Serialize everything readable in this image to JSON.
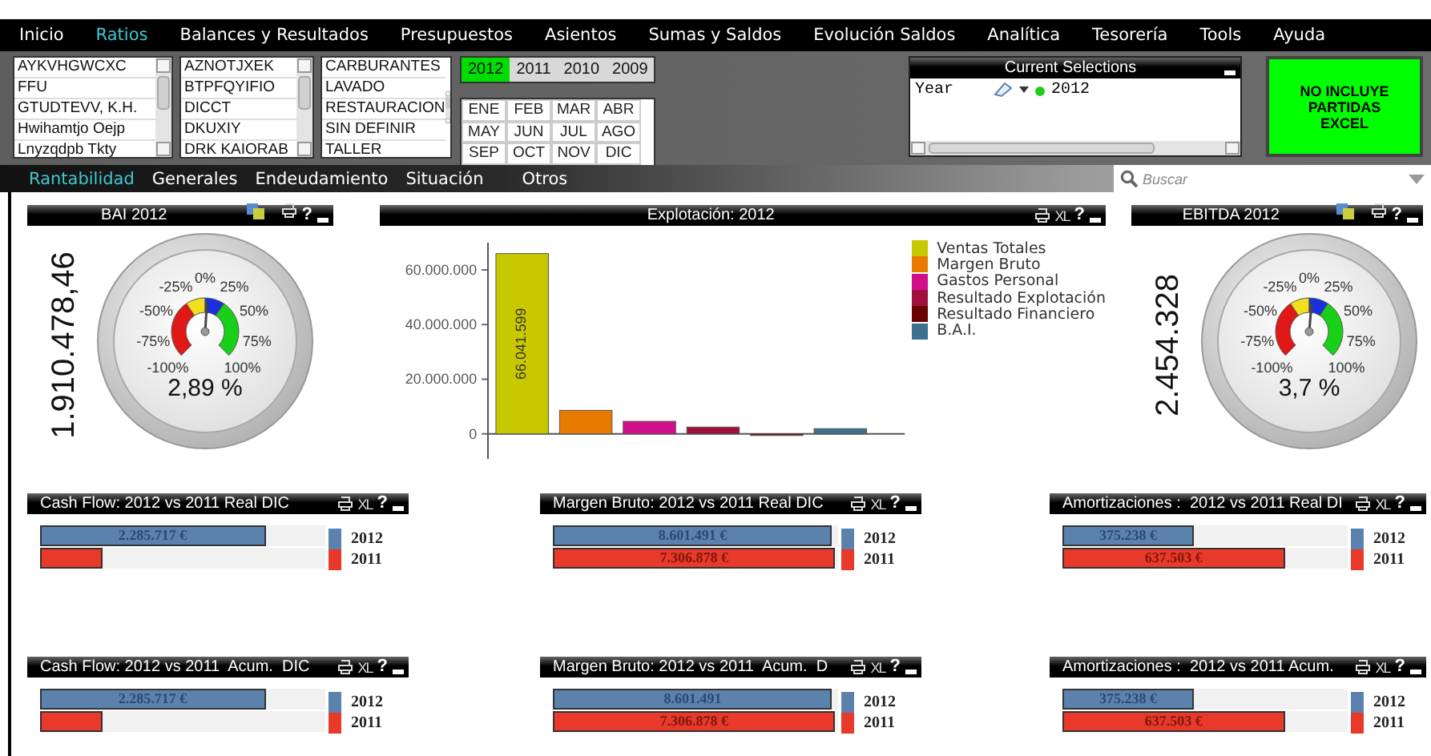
{
  "menu": [
    {
      "label": "Inicio",
      "selected": false
    },
    {
      "label": "Ratios",
      "selected": true
    },
    {
      "label": "Balances y Resultados",
      "selected": false
    },
    {
      "label": "Presupuestos",
      "selected": false
    },
    {
      "label": "Asientos",
      "selected": false
    },
    {
      "label": "Sumas y Saldos",
      "selected": false
    },
    {
      "label": "Evolución Saldos",
      "selected": false
    },
    {
      "label": "Analítica",
      "selected": false
    },
    {
      "label": "Tesorería",
      "selected": false
    },
    {
      "label": "Tools",
      "selected": false
    },
    {
      "label": "Ayuda",
      "selected": false
    }
  ],
  "listboxes": [
    {
      "items": [
        "AYKVHGWCXC",
        "FFU",
        "GTUDTEVV, K.H.",
        "Hwihamtjo Oejp",
        "Lnyzqdpb Tkty"
      ]
    },
    {
      "items": [
        "AZNOTJXEK",
        "BTPFQYIFIO",
        "DICCT",
        "DKUXIY",
        "DRK KAIORAB"
      ]
    },
    {
      "items": [
        "CARBURANTES",
        "LAVADO",
        "RESTAURACION",
        "SIN DEFINIR",
        "TALLER"
      ]
    }
  ],
  "years": [
    {
      "label": "2012",
      "selected": true
    },
    {
      "label": "2011",
      "selected": false
    },
    {
      "label": "2010",
      "selected": false
    },
    {
      "label": "2009",
      "selected": false
    }
  ],
  "months": [
    "ENE",
    "FEB",
    "MAR",
    "ABR",
    "MAY",
    "JUN",
    "JUL",
    "AGO",
    "SEP",
    "OCT",
    "NOV",
    "DIC"
  ],
  "current_selections": {
    "title": "Current Selections",
    "field": "Year",
    "value": "2012"
  },
  "excel_button": {
    "label": "NO INCLUYE PARTIDAS EXCEL"
  },
  "subtabs": [
    {
      "label": "Rantabilidad",
      "selected": true
    },
    {
      "label": "Generales",
      "selected": false
    },
    {
      "label": "Endeudamiento",
      "selected": false
    },
    {
      "label": "Situación",
      "selected": false
    },
    {
      "label": "Otros",
      "selected": false
    }
  ],
  "search": {
    "placeholder": "Buscar"
  },
  "gauges": [
    {
      "title": "BAI 2012",
      "value": "1.910.478,46",
      "reading": "2,89 %",
      "level": 0.514,
      "scale": [
        "-100%",
        "-75%",
        "-50%",
        "-25%",
        "0%",
        "25%",
        "50%",
        "75%",
        "100%"
      ],
      "tools": [
        {
          "kind": "copy"
        },
        {
          "kind": "print"
        },
        {
          "kind": "help",
          "label": "?"
        },
        {
          "kind": "minimize"
        }
      ]
    },
    {
      "title": "EBITDA 2012",
      "value": "2.454.328",
      "reading": "3,7 %",
      "level": 0.518,
      "scale": [
        "-100%",
        "-75%",
        "-50%",
        "-25%",
        "0%",
        "25%",
        "50%",
        "75%",
        "100%"
      ],
      "tools": [
        {
          "kind": "copy"
        },
        {
          "kind": "print"
        },
        {
          "kind": "help",
          "label": "?"
        },
        {
          "kind": "minimize"
        }
      ]
    }
  ],
  "explotacion": {
    "title": "Explotación: 2012",
    "tools": [
      {
        "kind": "print"
      },
      {
        "kind": "xl",
        "label": "XL"
      },
      {
        "kind": "help",
        "label": "?"
      },
      {
        "kind": "minimize"
      }
    ],
    "chart_data": {
      "type": "bar",
      "ylim": [
        -1000000,
        70000000
      ],
      "yticks": [
        {
          "value": 0,
          "label": "0"
        },
        {
          "value": 20000000,
          "label": "20.000.000"
        },
        {
          "value": 40000000,
          "label": "40.000.000"
        },
        {
          "value": 60000000,
          "label": "60.000.000"
        }
      ],
      "series": [
        {
          "name": "Ventas Totales",
          "color": "#c8c800",
          "values": [
            66000000
          ]
        },
        {
          "name": "Margen Bruto",
          "color": "#e87a00",
          "values": [
            8600000
          ]
        },
        {
          "name": "Gastos Personal",
          "color": "#d0108a",
          "values": [
            4600000
          ]
        },
        {
          "name": "Resultado Explotación",
          "color": "#a0103a",
          "values": [
            2500000
          ]
        },
        {
          "name": "Resultado Financiero",
          "color": "#6a0000",
          "values": [
            -600000
          ]
        },
        {
          "name": "B.A.I.",
          "color": "#3f6f8f",
          "values": [
            1900000
          ]
        }
      ],
      "value_labels": [
        "66.041.599",
        null,
        null,
        null,
        null,
        null
      ]
    }
  },
  "hbar_panels": [
    {
      "title": "Cash Flow: 2012 vs 2011 Real DIC",
      "tools": [
        {
          "kind": "print"
        },
        {
          "kind": "xl",
          "label": "XL"
        },
        {
          "kind": "help",
          "label": "?"
        },
        {
          "kind": "minimize"
        }
      ],
      "bars": [
        {
          "value": "2.285.717 €",
          "level": 0.79
        },
        {
          "level": 0.22
        }
      ],
      "legend": [
        {
          "label": "2012",
          "color": "#5b82ad"
        },
        {
          "label": "2011",
          "color": "#e8392a"
        }
      ]
    },
    {
      "title": "Margen Bruto: 2012 vs 2011 Real DIC",
      "tools": [
        {
          "kind": "print"
        },
        {
          "kind": "xl",
          "label": "XL"
        },
        {
          "kind": "help",
          "label": "?"
        },
        {
          "kind": "minimize"
        }
      ],
      "bars": [
        {
          "value": "8.601.491 €",
          "level": 0.98
        },
        {
          "value": "7.306.878 €",
          "level": 0.99
        }
      ],
      "legend": [
        {
          "label": "2012",
          "color": "#5b82ad"
        },
        {
          "label": "2011",
          "color": "#e8392a"
        }
      ]
    },
    {
      "title": "Amortizaciones :  2012 vs 2011 Real DI",
      "tools": [
        {
          "kind": "print"
        },
        {
          "kind": "xl",
          "label": "XL"
        },
        {
          "kind": "help",
          "label": "?"
        },
        {
          "kind": "minimize"
        }
      ],
      "bars": [
        {
          "value": "375.238 €",
          "level": 0.46
        },
        {
          "value": "637.503 €",
          "level": 0.78
        }
      ],
      "legend": [
        {
          "label": "2012",
          "color": "#5b82ad"
        },
        {
          "label": "2011",
          "color": "#e8392a"
        }
      ]
    },
    {
      "title": "Cash Flow: 2012 vs 2011  Acum.  DIC",
      "tools": [
        {
          "kind": "print"
        },
        {
          "kind": "xl",
          "label": "XL"
        },
        {
          "kind": "help",
          "label": "?"
        },
        {
          "kind": "minimize"
        }
      ],
      "bars": [
        {
          "value": "2.285.717 €",
          "level": 0.79
        },
        {
          "level": 0.22
        }
      ],
      "legend": [
        {
          "label": "2012",
          "color": "#5b82ad"
        },
        {
          "label": "2011",
          "color": "#e8392a"
        }
      ]
    },
    {
      "title": "Margen Bruto: 2012 vs 2011  Acum.  D",
      "tools": [
        {
          "kind": "print"
        },
        {
          "kind": "xl",
          "label": "XL"
        },
        {
          "kind": "help",
          "label": "?"
        },
        {
          "kind": "minimize"
        }
      ],
      "bars": [
        {
          "value": "8.601.491",
          "level": 0.98
        },
        {
          "value": "7.306.878 €",
          "level": 0.99
        }
      ],
      "legend": [
        {
          "label": "2012",
          "color": "#5b82ad"
        },
        {
          "label": "2011",
          "color": "#e8392a"
        }
      ]
    },
    {
      "title": "Amortizaciones :  2012 vs 2011 Acum.",
      "tools": [
        {
          "kind": "print"
        },
        {
          "kind": "xl",
          "label": "XL"
        },
        {
          "kind": "help",
          "label": "?"
        },
        {
          "kind": "minimize"
        }
      ],
      "bars": [
        {
          "value": "375.238 €",
          "level": 0.46
        },
        {
          "value": "637.503 €",
          "level": 0.78
        }
      ],
      "legend": [
        {
          "label": "2012",
          "color": "#5b82ad"
        },
        {
          "label": "2011",
          "color": "#e8392a"
        }
      ]
    }
  ]
}
